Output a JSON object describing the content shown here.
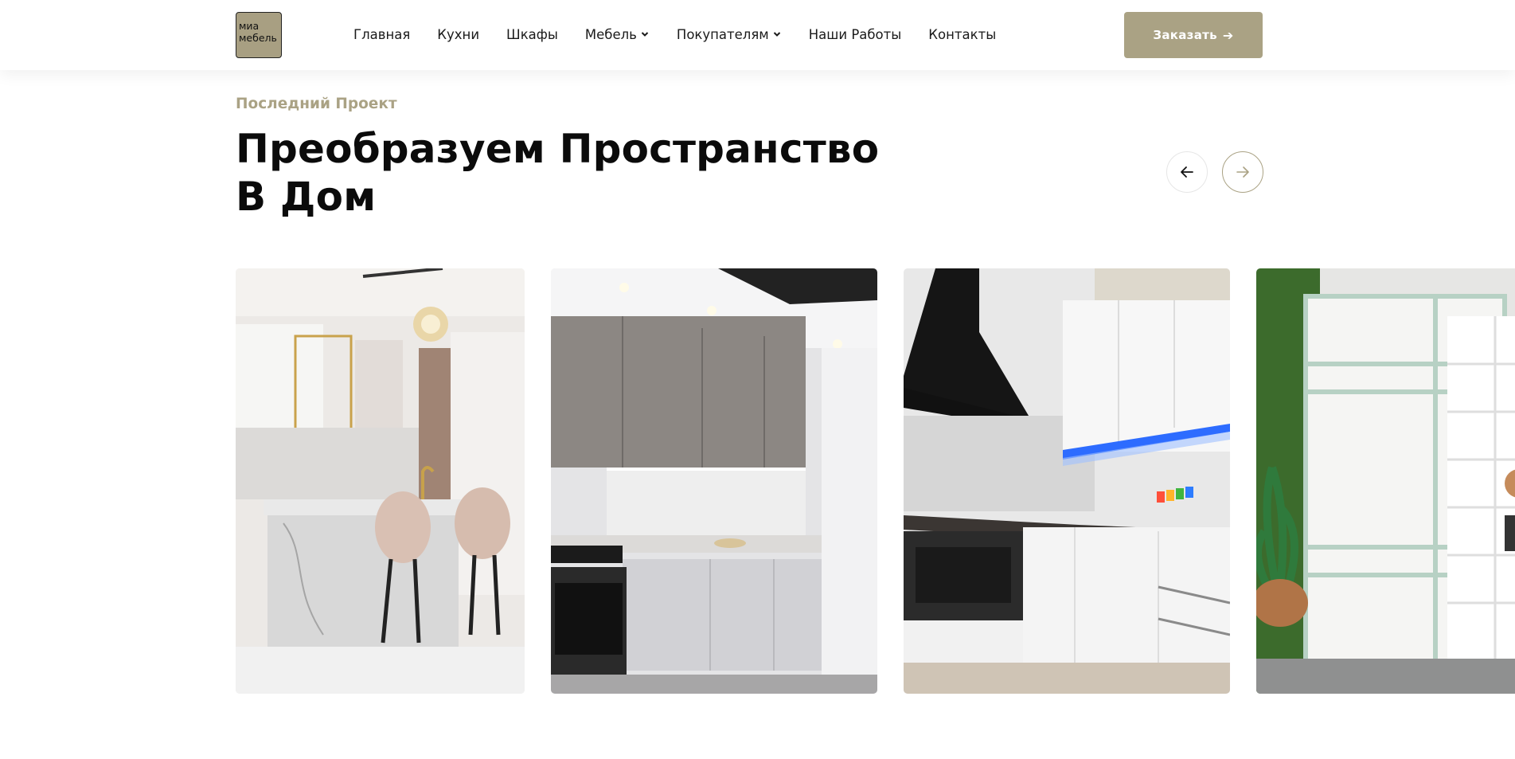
{
  "brand": {
    "logo_line1": "миа",
    "logo_line2": "мебель",
    "accent_color": "#aaa284"
  },
  "nav": {
    "items": [
      {
        "label": "Главная",
        "dropdown": false
      },
      {
        "label": "Кухни",
        "dropdown": false
      },
      {
        "label": "Шкафы",
        "dropdown": false
      },
      {
        "label": "Мебель",
        "dropdown": true
      },
      {
        "label": "Покупателям",
        "dropdown": true
      },
      {
        "label": "Наши Работы",
        "dropdown": false
      },
      {
        "label": "Контакты",
        "dropdown": false
      }
    ]
  },
  "header": {
    "order_label": "Заказать",
    "order_icon": "arrow-right-icon"
  },
  "section": {
    "eyebrow": "Последний Проект",
    "title_line1": "Преобразуем Пространство",
    "title_line2": "В Дом",
    "prev_icon": "arrow-left-icon",
    "next_icon": "arrow-right-icon"
  },
  "slides": [
    {
      "subject": "white marble kitchen island with chandelier and velvet bar stools"
    },
    {
      "subject": "grey and white modern kitchen with oven and tiled backsplash"
    },
    {
      "subject": "white glossy corner kitchen with blue LED lighting and black hood"
    },
    {
      "subject": "white wardrobe with mint frame and shelving on green wall"
    }
  ]
}
